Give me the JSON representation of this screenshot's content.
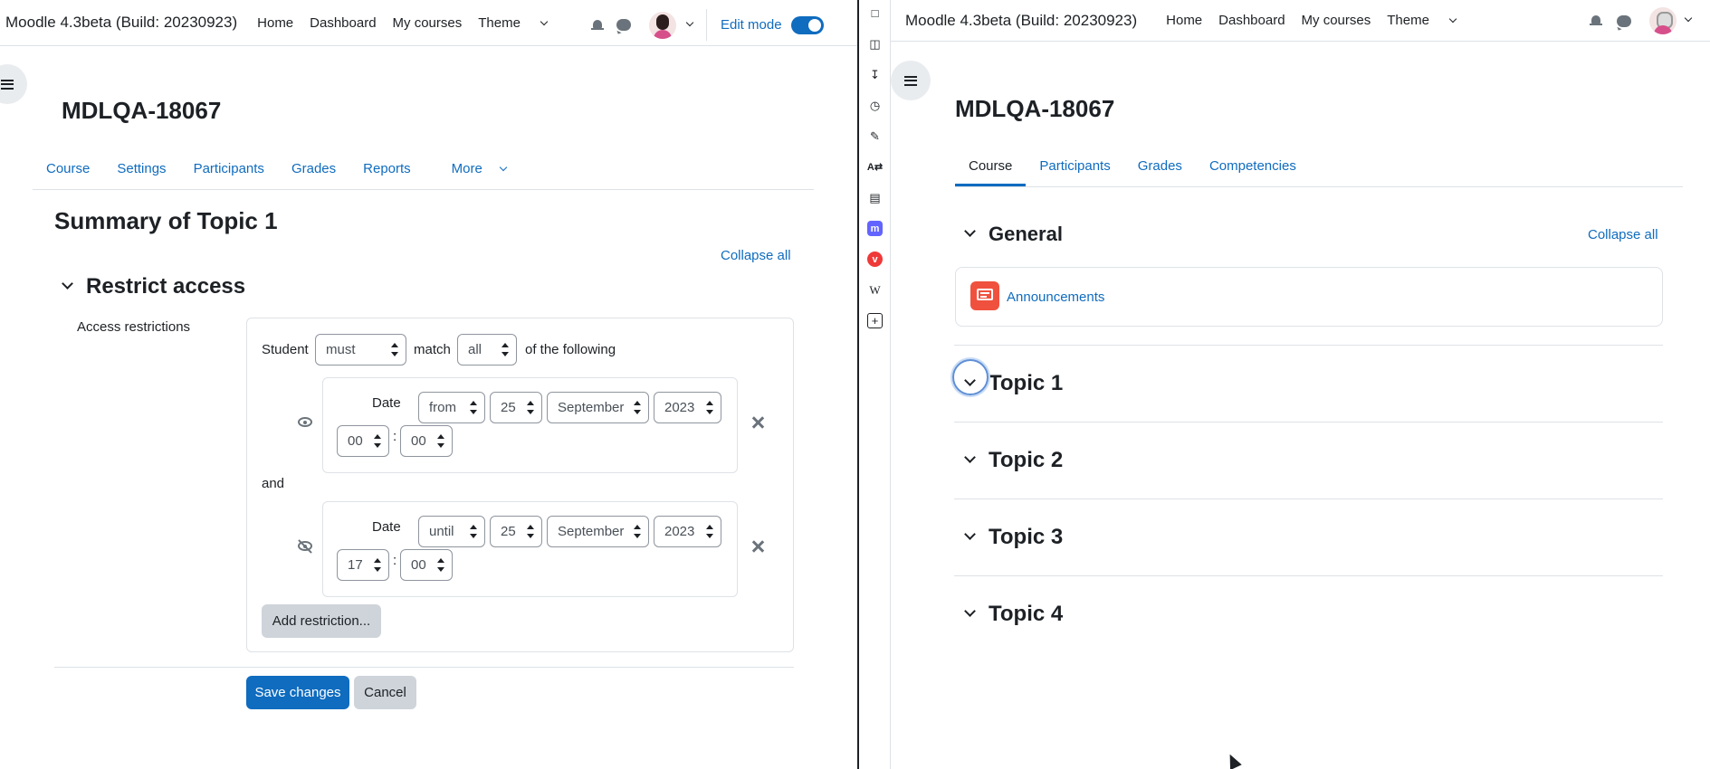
{
  "left": {
    "brand": "Moodle 4.3beta (Build: 20230923)",
    "nav": {
      "home": "Home",
      "dashboard": "Dashboard",
      "my_courses": "My courses",
      "theme": "Theme"
    },
    "edit_mode_label": "Edit mode",
    "course_title": "MDLQA-18067",
    "secnav": {
      "course": "Course",
      "settings": "Settings",
      "participants": "Participants",
      "grades": "Grades",
      "reports": "Reports",
      "more": "More"
    },
    "page_heading": "Summary of Topic 1",
    "collapse_all": "Collapse all",
    "section_heading": "Restrict access",
    "access_label": "Access restrictions",
    "student": "Student",
    "must_select": "must",
    "match": "match",
    "all_select": "all",
    "of_following": "of the following",
    "and": "and",
    "cond1": {
      "label": "Date",
      "dir": "from",
      "day": "25",
      "month": "September",
      "year": "2023",
      "hour": "00",
      "minute": "00"
    },
    "cond2": {
      "label": "Date",
      "dir": "until",
      "day": "25",
      "month": "September",
      "year": "2023",
      "hour": "17",
      "minute": "00"
    },
    "colon": ":",
    "add_restriction": "Add restriction...",
    "save_changes": "Save changes",
    "cancel": "Cancel"
  },
  "right": {
    "brand": "Moodle 4.3beta (Build: 20230923)",
    "nav": {
      "home": "Home",
      "dashboard": "Dashboard",
      "my_courses": "My courses",
      "theme": "Theme"
    },
    "course_title": "MDLQA-18067",
    "secnav": {
      "course": "Course",
      "participants": "Participants",
      "grades": "Grades",
      "competencies": "Competencies"
    },
    "general": "General",
    "collapse_all": "Collapse all",
    "announcements": "Announcements",
    "topics": [
      "Topic 1",
      "Topic 2",
      "Topic 3",
      "Topic 4"
    ]
  },
  "toolbar_icons": [
    "bookmark-icon",
    "reader-icon",
    "download-icon",
    "history-icon",
    "edit-icon",
    "translate-icon",
    "window-icon",
    "mastodon-icon",
    "vivaldi-icon",
    "wikipedia-icon",
    "add-panel-icon"
  ],
  "colors": {
    "accent": "#0f6cbf",
    "text": "#1d2125",
    "border": "#dee2e6",
    "announce": "#f0513f"
  }
}
